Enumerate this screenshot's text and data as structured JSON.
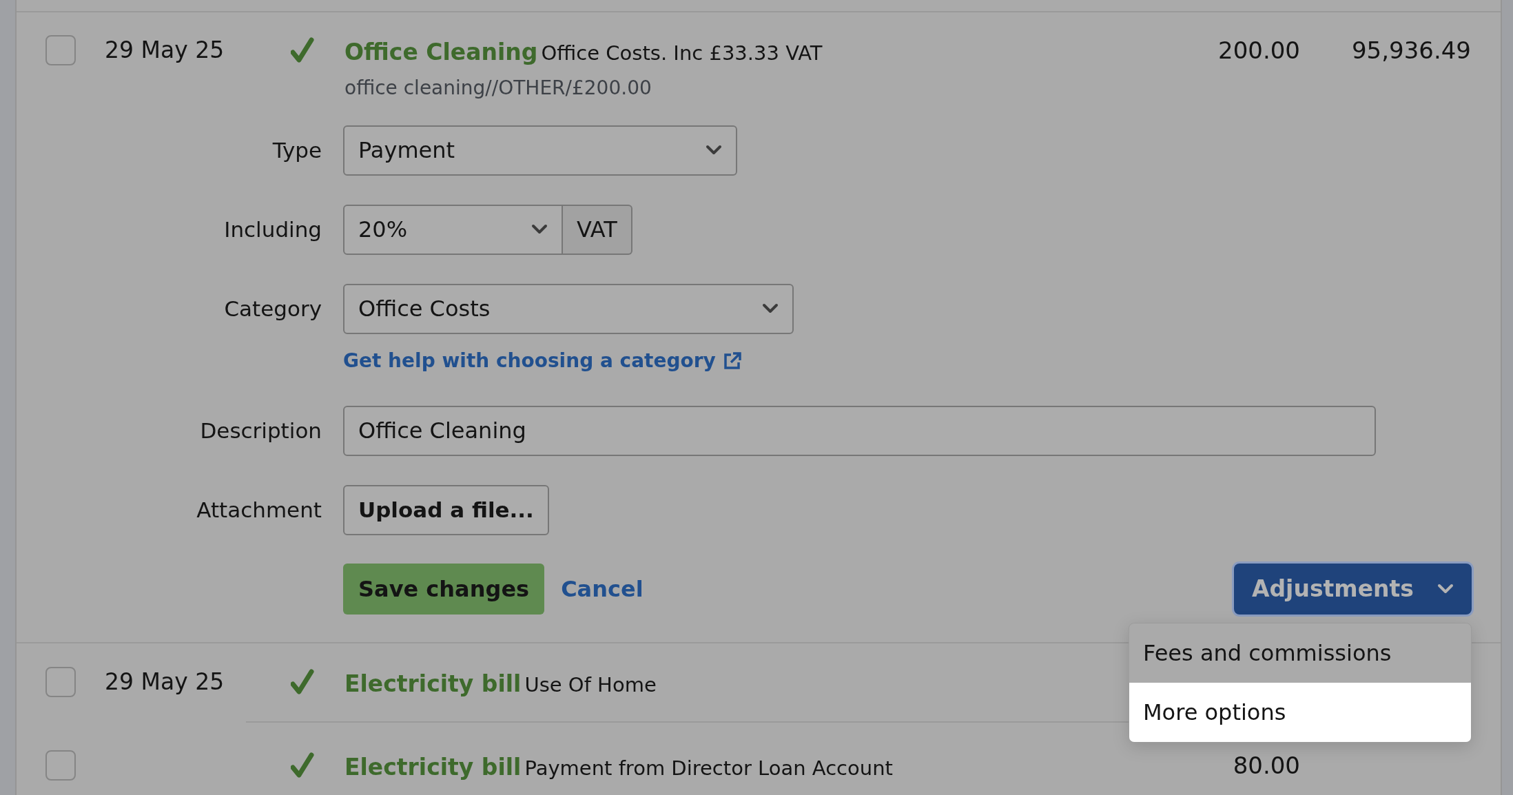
{
  "transactions": [
    {
      "checked": false,
      "date": "29 May 25",
      "reconciled": true,
      "title": "Office Cleaning",
      "detail": "Office Costs. Inc £33.33 VAT",
      "reference": "office cleaning//OTHER/£200.00",
      "amount": "200.00",
      "balance": "95,936.49"
    },
    {
      "checked": false,
      "date": "29 May 25",
      "reconciled": true,
      "title": "Electricity bill",
      "detail": "Use Of Home"
    },
    {
      "checked": false,
      "reconciled": true,
      "title": "Electricity bill",
      "detail": "Payment from Director Loan Account",
      "amount": "80.00"
    }
  ],
  "edit_form": {
    "fields": [
      {
        "kind": "select",
        "label": "Type",
        "value": "Payment"
      },
      {
        "kind": "select-addon",
        "label": "Including",
        "value": "20%",
        "addon": "VAT"
      },
      {
        "kind": "select",
        "label": "Category",
        "value": "Office Costs",
        "help_link": "Get help with choosing a category"
      },
      {
        "kind": "input",
        "label": "Description",
        "value": "Office Cleaning"
      },
      {
        "kind": "upload",
        "label": "Attachment",
        "button": "Upload a file..."
      }
    ],
    "save_button": "Save changes",
    "cancel_link": "Cancel",
    "adjustments": {
      "label": "Adjustments",
      "expanded": true,
      "items": [
        {
          "label": "Fees and commissions",
          "selected": false
        },
        {
          "label": "More options",
          "selected": true
        }
      ]
    }
  }
}
